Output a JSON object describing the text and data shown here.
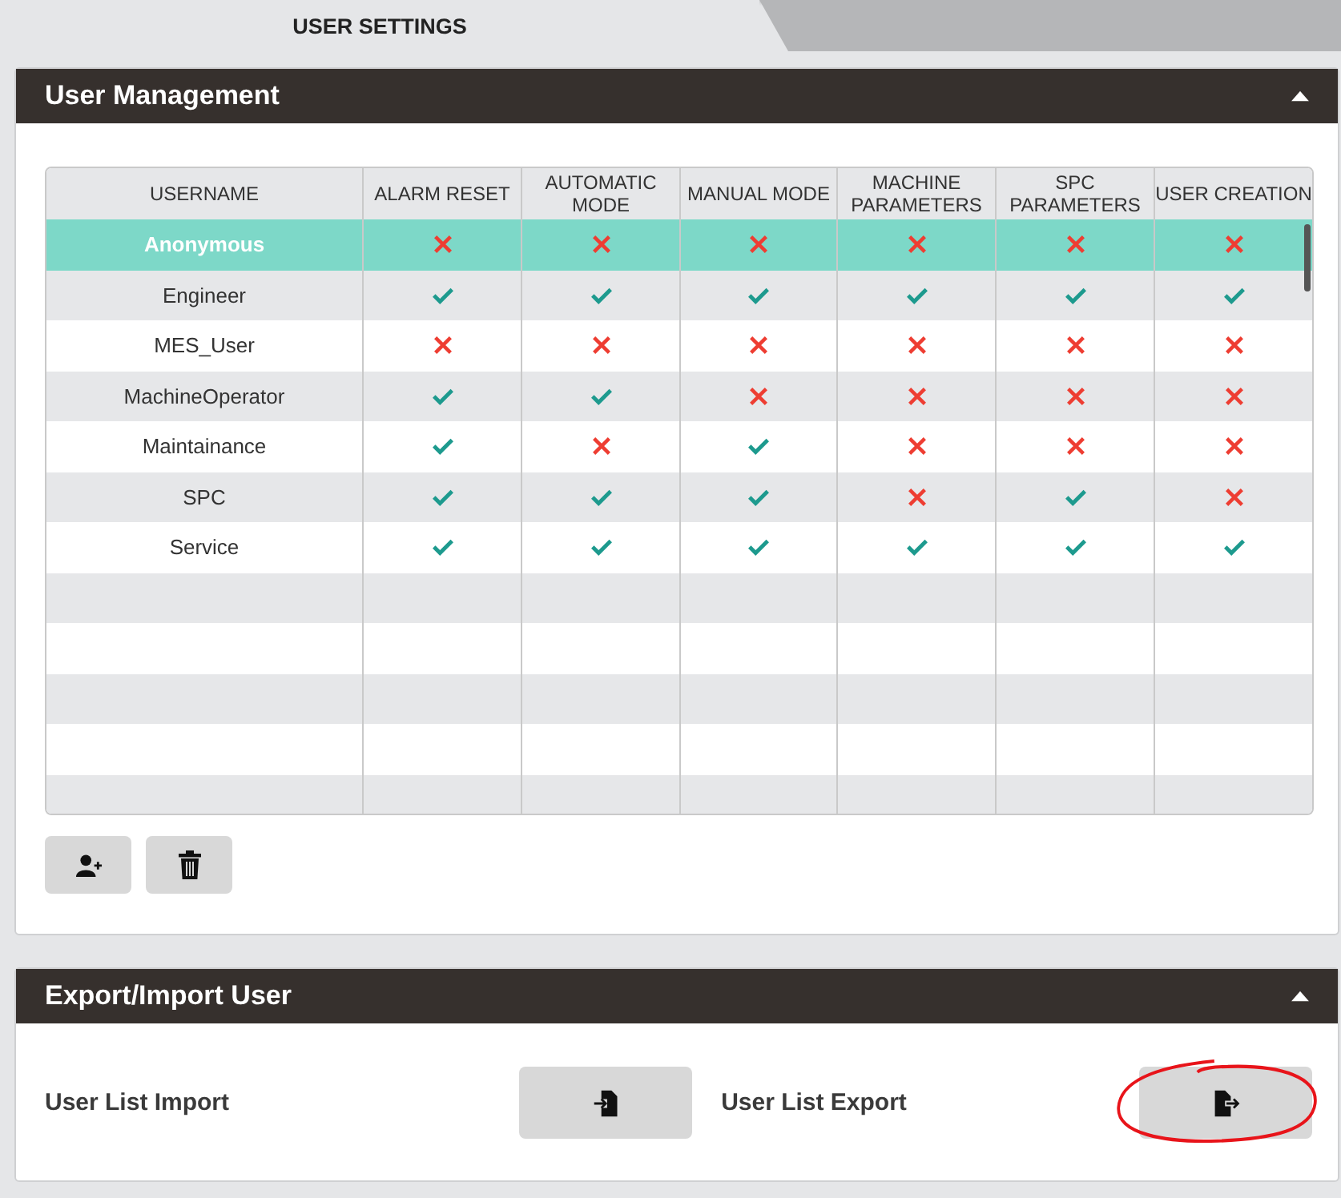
{
  "tabs": [
    {
      "label": "USER SETTINGS",
      "selected": true
    }
  ],
  "user_management": {
    "title": "User Management",
    "expanded": true,
    "table": {
      "columns": [
        "USERNAME",
        "ALARM RESET",
        "AUTOMATIC MODE",
        "MANUAL MODE",
        "MACHINE PARAMETERS",
        "SPC PARAMETERS",
        "USER CREATION"
      ],
      "rows": [
        {
          "username": "Anonymous",
          "selected": true,
          "permissions": [
            false,
            false,
            false,
            false,
            false,
            false
          ]
        },
        {
          "username": "Engineer",
          "selected": false,
          "permissions": [
            true,
            true,
            true,
            true,
            true,
            true
          ]
        },
        {
          "username": "MES_User",
          "selected": false,
          "permissions": [
            false,
            false,
            false,
            false,
            false,
            false
          ]
        },
        {
          "username": "MachineOperator",
          "selected": false,
          "permissions": [
            true,
            true,
            false,
            false,
            false,
            false
          ]
        },
        {
          "username": "Maintainance",
          "selected": false,
          "permissions": [
            true,
            false,
            true,
            false,
            false,
            false
          ]
        },
        {
          "username": "SPC",
          "selected": false,
          "permissions": [
            true,
            true,
            true,
            false,
            true,
            false
          ]
        },
        {
          "username": "Service",
          "selected": false,
          "permissions": [
            true,
            true,
            true,
            true,
            true,
            true
          ]
        }
      ]
    },
    "buttons": [
      {
        "kind": "add-user"
      },
      {
        "kind": "delete"
      }
    ]
  },
  "export_import": {
    "title": "Export/Import User",
    "expanded": true,
    "items": [
      {
        "label": "User List Import",
        "kind": "import",
        "circled": false
      },
      {
        "label": "User List Export",
        "kind": "export",
        "circled": true
      }
    ]
  }
}
